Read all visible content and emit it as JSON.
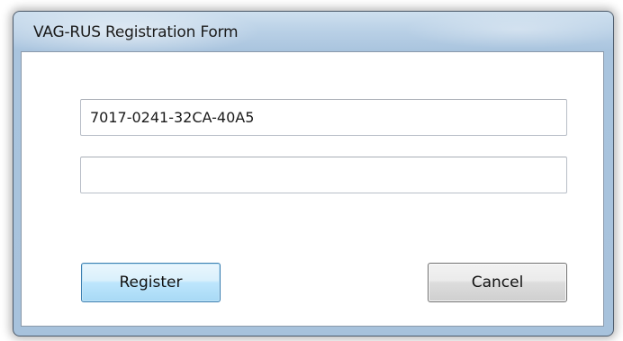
{
  "window": {
    "title": "VAG-RUS Registration Form"
  },
  "form": {
    "serial_value": "7017-0241-32CA-40A5",
    "key_value": ""
  },
  "buttons": {
    "register_label": "Register",
    "cancel_label": "Cancel"
  },
  "colors": {
    "title_bar": "#b9d0e6",
    "register_border": "#3c7fb1",
    "cancel_border": "#707070"
  }
}
